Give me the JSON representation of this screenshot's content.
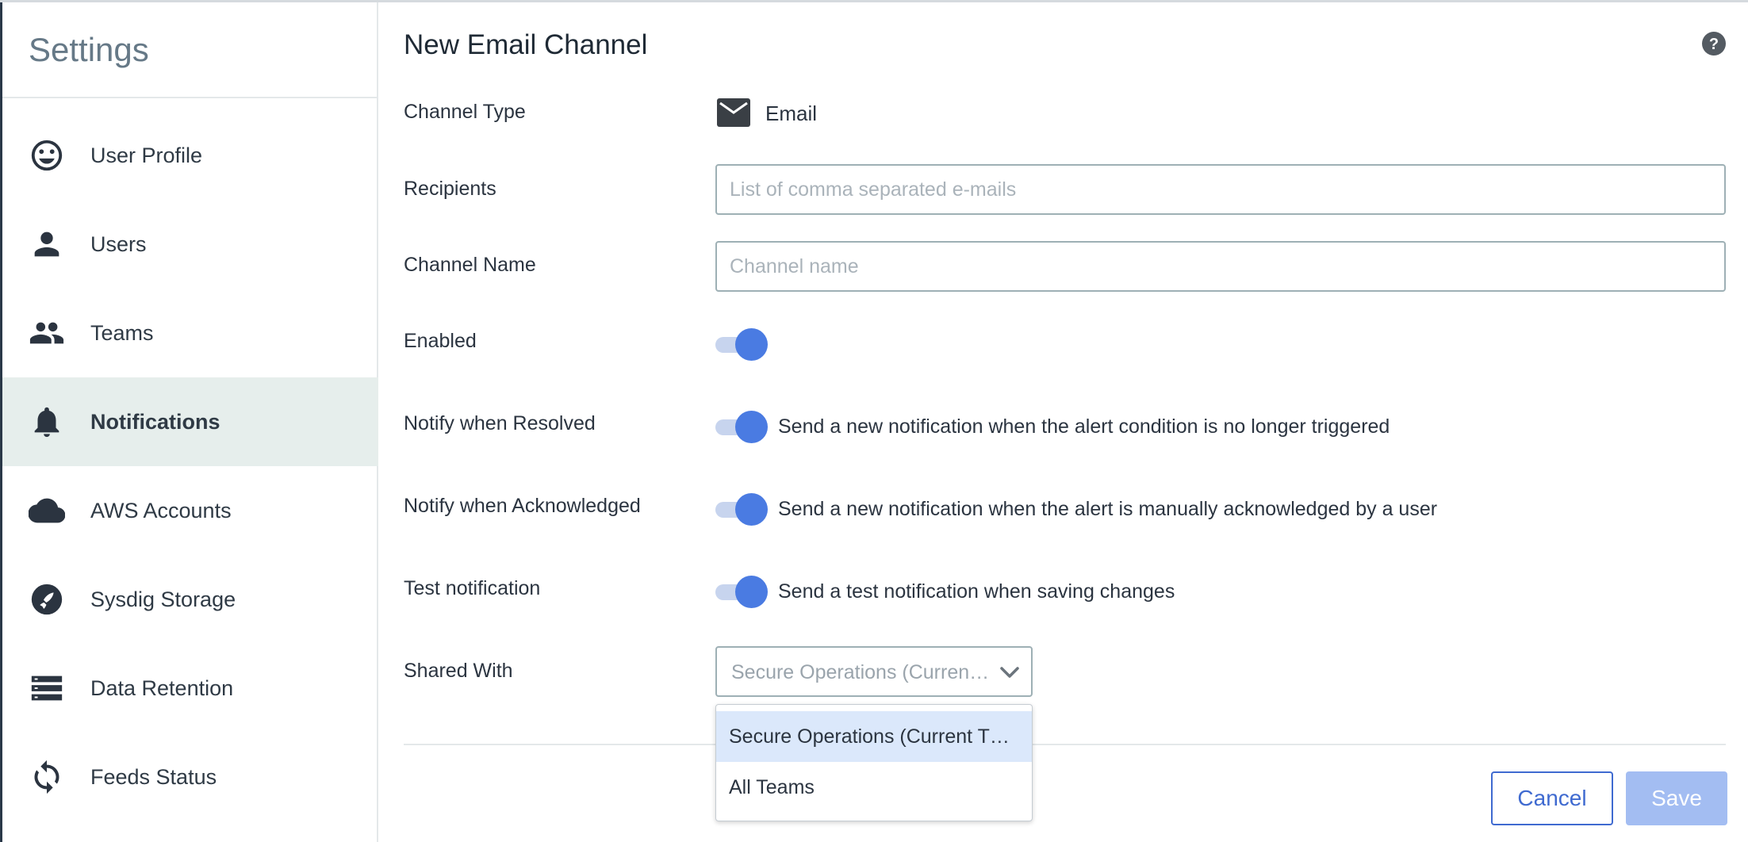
{
  "sidebar": {
    "title": "Settings",
    "items": [
      {
        "label": "User Profile",
        "icon": "smiley-face-icon",
        "active": false
      },
      {
        "label": "Users",
        "icon": "person-icon",
        "active": false
      },
      {
        "label": "Teams",
        "icon": "group-icon",
        "active": false
      },
      {
        "label": "Notifications",
        "icon": "bell-icon",
        "active": true
      },
      {
        "label": "AWS Accounts",
        "icon": "cloud-icon",
        "active": false
      },
      {
        "label": "Sysdig Storage",
        "icon": "rocket-icon",
        "active": false
      },
      {
        "label": "Data Retention",
        "icon": "storage-list-icon",
        "active": false
      },
      {
        "label": "Feeds Status",
        "icon": "sync-icon",
        "active": false
      }
    ]
  },
  "main": {
    "title": "New Email Channel",
    "help_icon": "help-circle-icon",
    "channel_type": {
      "label": "Channel Type",
      "value": "Email",
      "icon": "envelope-icon"
    },
    "recipients": {
      "label": "Recipients",
      "placeholder": "List of comma separated e-mails",
      "value": ""
    },
    "channel_name": {
      "label": "Channel Name",
      "placeholder": "Channel name",
      "value": ""
    },
    "enabled": {
      "label": "Enabled",
      "on": true
    },
    "notify_resolved": {
      "label": "Notify when Resolved",
      "on": true,
      "description": "Send a new notification when the alert condition is no longer triggered"
    },
    "notify_acknowledged": {
      "label": "Notify when Acknowledged",
      "on": true,
      "description": "Send a new notification when the alert is manually acknowledged by a user"
    },
    "test_notification": {
      "label": "Test notification",
      "on": true,
      "description": "Send a test notification when saving changes"
    },
    "shared_with": {
      "label": "Shared With",
      "selected": "Secure Operations (Curren…",
      "options": [
        "Secure Operations (Current T…",
        "All Teams"
      ]
    },
    "buttons": {
      "cancel": "Cancel",
      "save": "Save"
    }
  },
  "colors": {
    "accent": "#4a7be2",
    "active_nav_bg": "#e6eeec",
    "save_disabled": "#a3bdf2"
  }
}
